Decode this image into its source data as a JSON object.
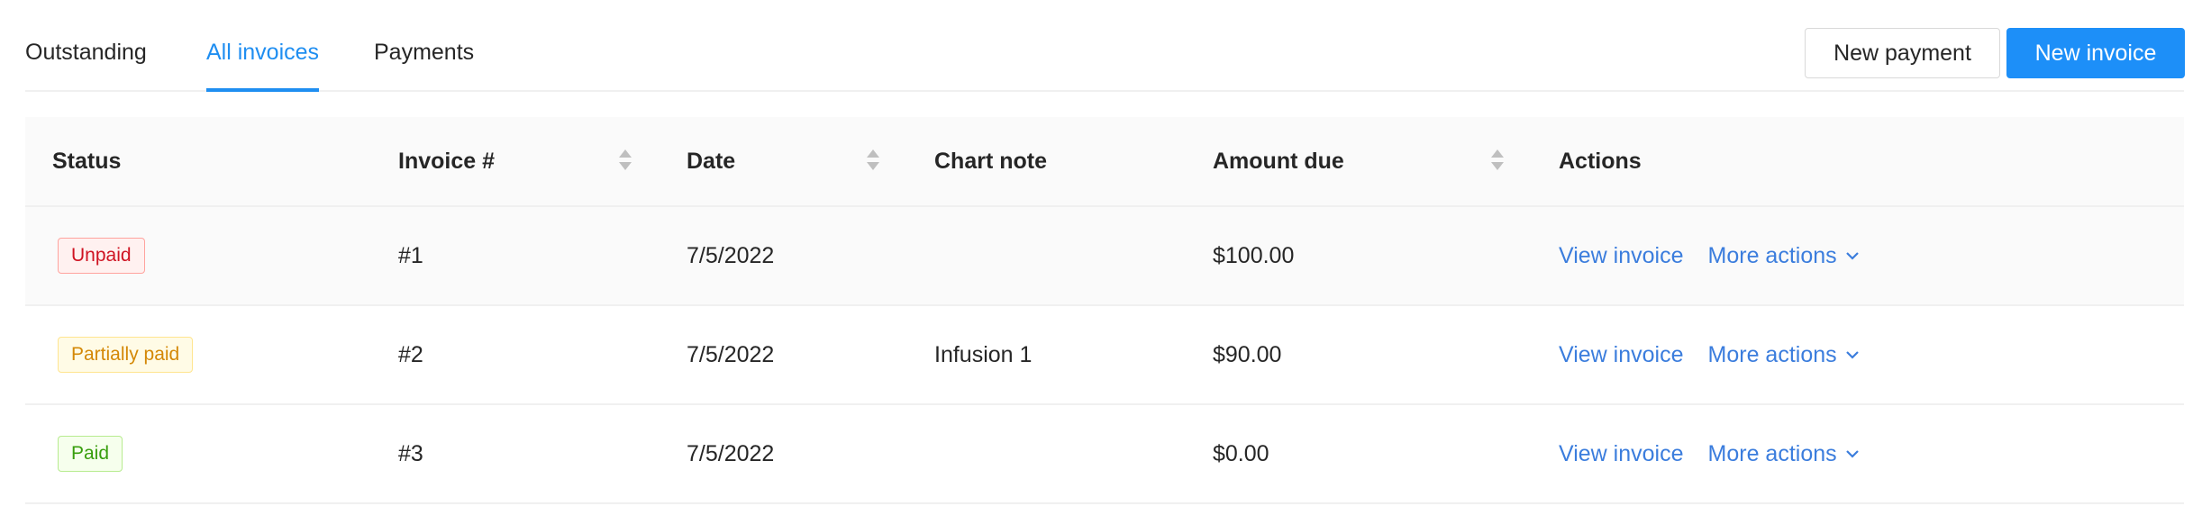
{
  "tabs": [
    {
      "label": "Outstanding",
      "active": false
    },
    {
      "label": "All invoices",
      "active": true
    },
    {
      "label": "Payments",
      "active": false
    }
  ],
  "buttons": {
    "new_payment": "New payment",
    "new_invoice": "New invoice"
  },
  "colors": {
    "accent": "#1d8ff8",
    "link": "#3b7ddd",
    "unpaid": "#cf1322",
    "partially_paid": "#d48806",
    "paid": "#389e0d"
  },
  "table": {
    "columns": [
      {
        "label": "Status",
        "sortable": false
      },
      {
        "label": "Invoice #",
        "sortable": true
      },
      {
        "label": "Date",
        "sortable": true
      },
      {
        "label": "Chart note",
        "sortable": false
      },
      {
        "label": "Amount due",
        "sortable": true
      },
      {
        "label": "Actions",
        "sortable": false
      }
    ],
    "rows": [
      {
        "status": "Unpaid",
        "status_kind": "unpaid",
        "invoice": "#1",
        "date": "7/5/2022",
        "chart_note": "",
        "amount_due": "$100.00",
        "view": "View invoice",
        "more": "More actions"
      },
      {
        "status": "Partially paid",
        "status_kind": "partially_paid",
        "invoice": "#2",
        "date": "7/5/2022",
        "chart_note": "Infusion 1",
        "amount_due": "$90.00",
        "view": "View invoice",
        "more": "More actions"
      },
      {
        "status": "Paid",
        "status_kind": "paid",
        "invoice": "#3",
        "date": "7/5/2022",
        "chart_note": "",
        "amount_due": "$0.00",
        "view": "View invoice",
        "more": "More actions"
      }
    ]
  },
  "icons": {
    "sort": "caret-up-down-icon",
    "more_actions": "chevron-down-icon"
  }
}
